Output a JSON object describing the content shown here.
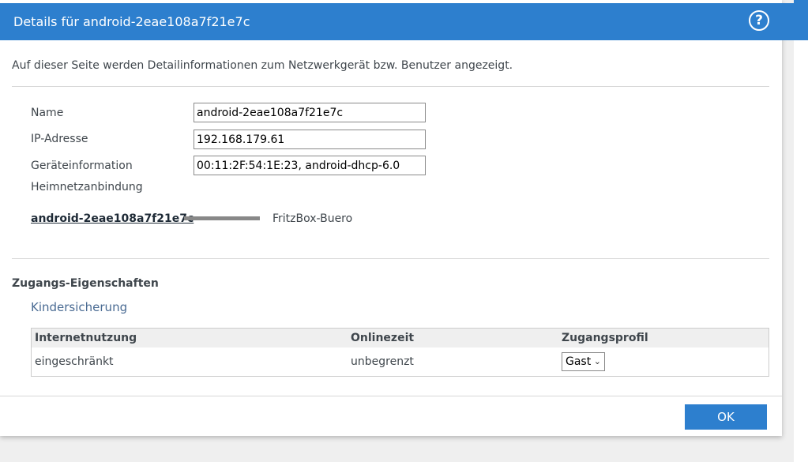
{
  "dialog": {
    "title": "Details für android-2eae108a7f21e7c",
    "help_icon": "question-circle-icon",
    "intro": "Auf dieser Seite werden Detailinformationen zum Netzwerkgerät bzw. Benutzer angezeigt."
  },
  "details": {
    "name_label": "Name",
    "name_value": "android-2eae108a7f21e7c",
    "ip_label": "IP-Adresse",
    "ip_value": "192.168.179.61",
    "info_label": "Geräteinformation",
    "info_value": "00:11:2F:54:1E:23, android-dhcp-6.0",
    "home_network_label": "Heimnetzanbindung"
  },
  "connection": {
    "device": "android-2eae108a7f21e7c",
    "router": "FritzBox-Buero"
  },
  "access": {
    "section_title": "Zugangs-Eigenschaften",
    "parental_control_link": "Kindersicherung",
    "columns": [
      "Internetnutzung",
      "Onlinezeit",
      "Zugangsprofil"
    ],
    "rows": [
      {
        "usage": "eingeschränkt",
        "online_time": "unbegrenzt",
        "profile": "Gast"
      }
    ]
  },
  "footer": {
    "ok_label": "OK"
  },
  "colors": {
    "accent": "#2d7fce",
    "link": "#4a6b93",
    "text": "#3f464c"
  }
}
